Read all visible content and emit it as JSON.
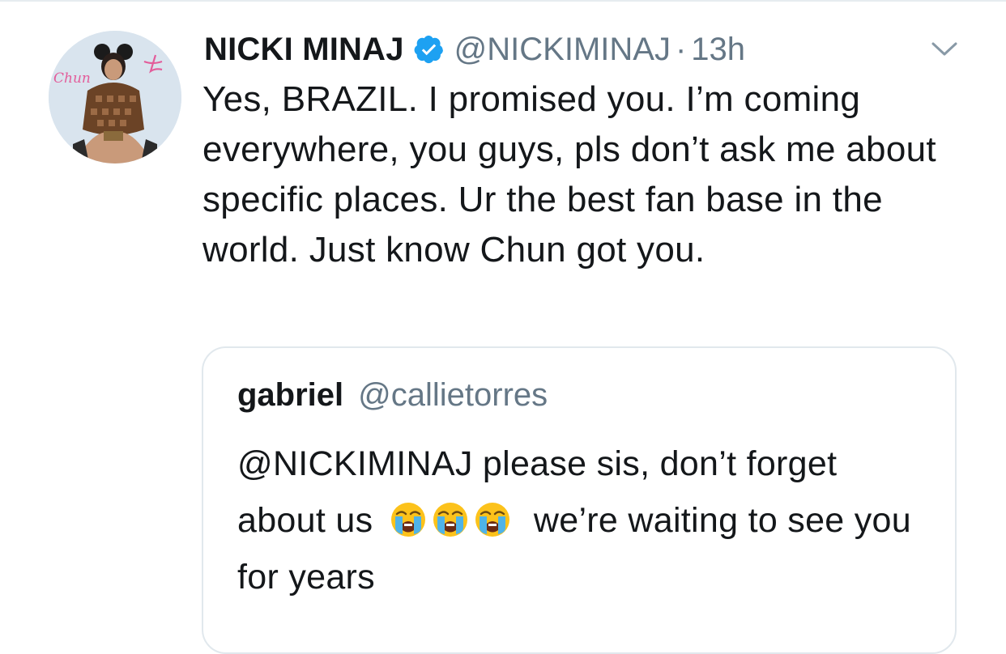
{
  "tweet": {
    "author": {
      "display_name": "NICKI MINAJ",
      "handle": "@NICKIMINAJ",
      "verified": true
    },
    "separator": "·",
    "timestamp": "13h",
    "text": "Yes, BRAZIL. I promised you. I’m coming everywhere, you guys, pls don’t ask me about specific places. Ur the best fan base in the world. Just know Chun got you.",
    "menu_icon": "chevron-down-icon",
    "avatar_icon": "avatar-image",
    "avatar_script_text": "Chun"
  },
  "quoted_tweet": {
    "display_name": "gabriel",
    "handle": "@callietorres",
    "text_before_emoji": "@NICKIMINAJ please sis, don’t forget about us",
    "emoji": [
      "😭",
      "😭",
      "😭"
    ],
    "emoji_icon": "loudly-crying-face-icon",
    "text_after_emoji": "we’re waiting to see you for years"
  },
  "colors": {
    "primary_text": "#14171a",
    "secondary_text": "#657786",
    "verified_blue": "#1da1f2",
    "border": "#e1e8ed"
  }
}
